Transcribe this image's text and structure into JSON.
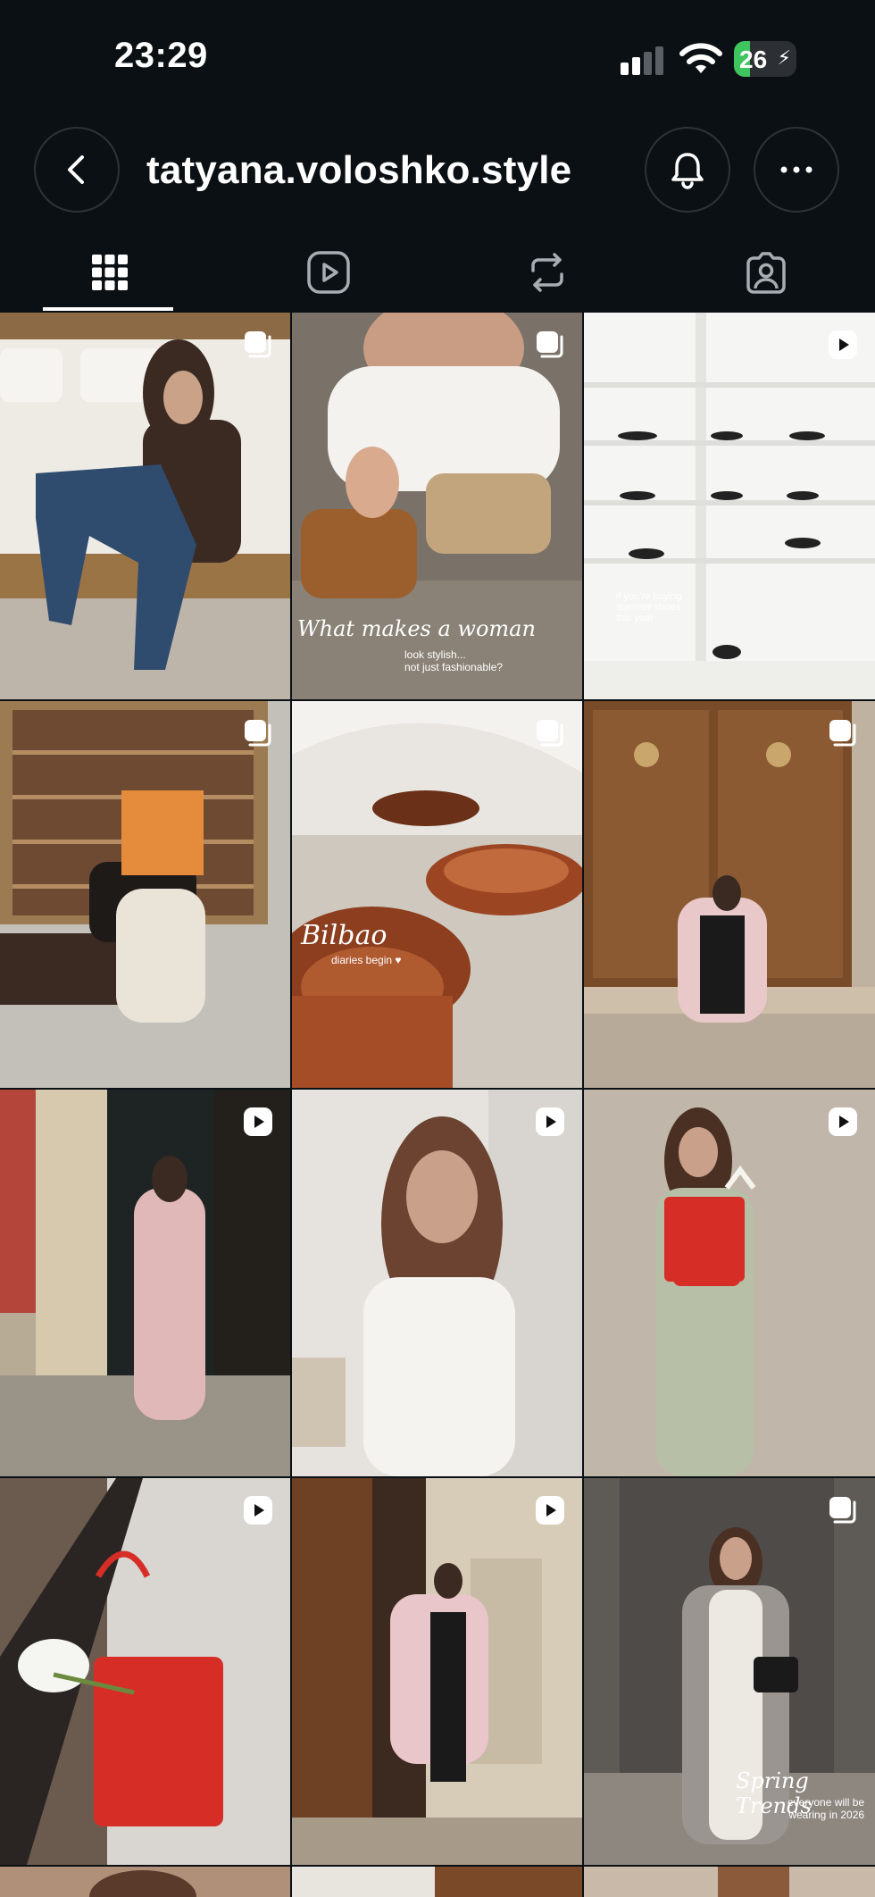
{
  "status_bar": {
    "time": "23:29",
    "battery": "26",
    "battery_level": 0.26
  },
  "header": {
    "username": "tatyana.voloshko.style"
  },
  "tabs": [
    {
      "name": "grid"
    },
    {
      "name": "reels"
    },
    {
      "name": "reposts"
    },
    {
      "name": "tagged"
    }
  ],
  "posts": [
    {
      "type": "carousel",
      "caption_script": "",
      "caption_small": ""
    },
    {
      "type": "carousel",
      "caption_script": "What makes a woman",
      "caption_small": "look stylish...\nnot just fashionable?"
    },
    {
      "type": "reel",
      "caption_script": "",
      "caption_small": "if you're buying\nsummer shoes\nthis year"
    },
    {
      "type": "carousel",
      "caption_script": "",
      "caption_small": ""
    },
    {
      "type": "carousel",
      "caption_script": "Bilbao",
      "caption_small": "diaries begin ♥"
    },
    {
      "type": "carousel",
      "caption_script": "",
      "caption_small": ""
    },
    {
      "type": "reel",
      "caption_script": "",
      "caption_small": ""
    },
    {
      "type": "reel",
      "caption_script": "",
      "caption_small": ""
    },
    {
      "type": "reel",
      "caption_script": "",
      "caption_small": ""
    },
    {
      "type": "reel",
      "caption_script": "",
      "caption_small": ""
    },
    {
      "type": "reel",
      "caption_script": "",
      "caption_small": ""
    },
    {
      "type": "carousel",
      "caption_script": "Spring Trends",
      "caption_small": "everyone will be\nwearing in 2026"
    }
  ],
  "colors": {
    "background": "#0b1014",
    "battery_green": "#3ec55e"
  }
}
